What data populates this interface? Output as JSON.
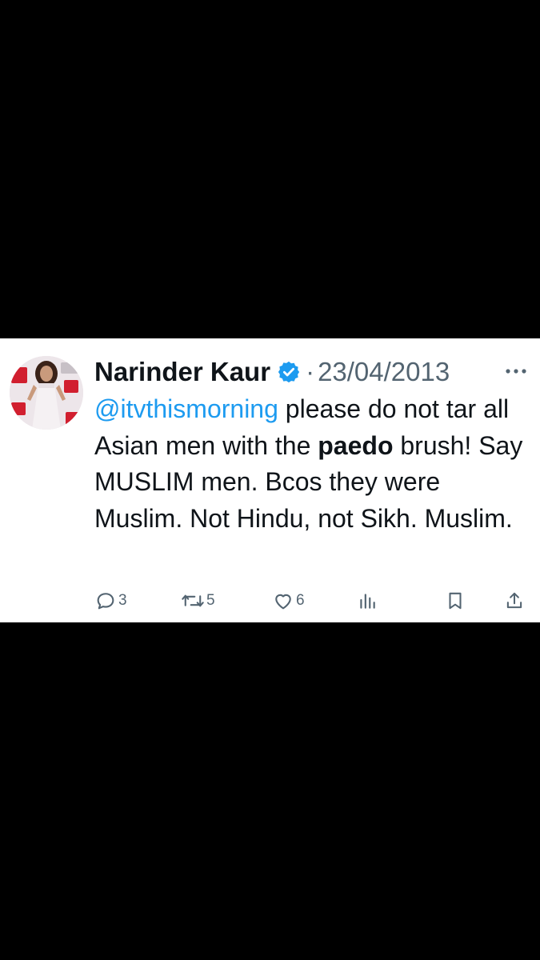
{
  "tweet": {
    "author_name": "Narinder Kaur",
    "separator": "·",
    "date": "23/04/2013",
    "text_segments": [
      {
        "text": "@itvthismorning",
        "style": "mention"
      },
      {
        "text": " please do not tar all Asian men with the ",
        "style": "normal"
      },
      {
        "text": "paedo",
        "style": "bold"
      },
      {
        "text": " brush! Say MUSLIM men. Bcos they were Muslim. Not Hindu, not Sikh. Muslim.",
        "style": "normal"
      }
    ],
    "actions": {
      "replies": "3",
      "reposts": "5",
      "likes": "6"
    }
  },
  "icons": {
    "verified": "verified-badge-icon",
    "more": "more-dots-icon",
    "reply": "reply-bubble-icon",
    "repost": "repost-arrows-icon",
    "like": "heart-icon",
    "views": "bar-chart-icon",
    "bookmark": "bookmark-icon",
    "share": "share-arrow-icon"
  },
  "colors": {
    "background": "#000000",
    "card": "#ffffff",
    "text": "#0f1419",
    "secondary": "#536471",
    "accent": "#1d9bf0"
  }
}
